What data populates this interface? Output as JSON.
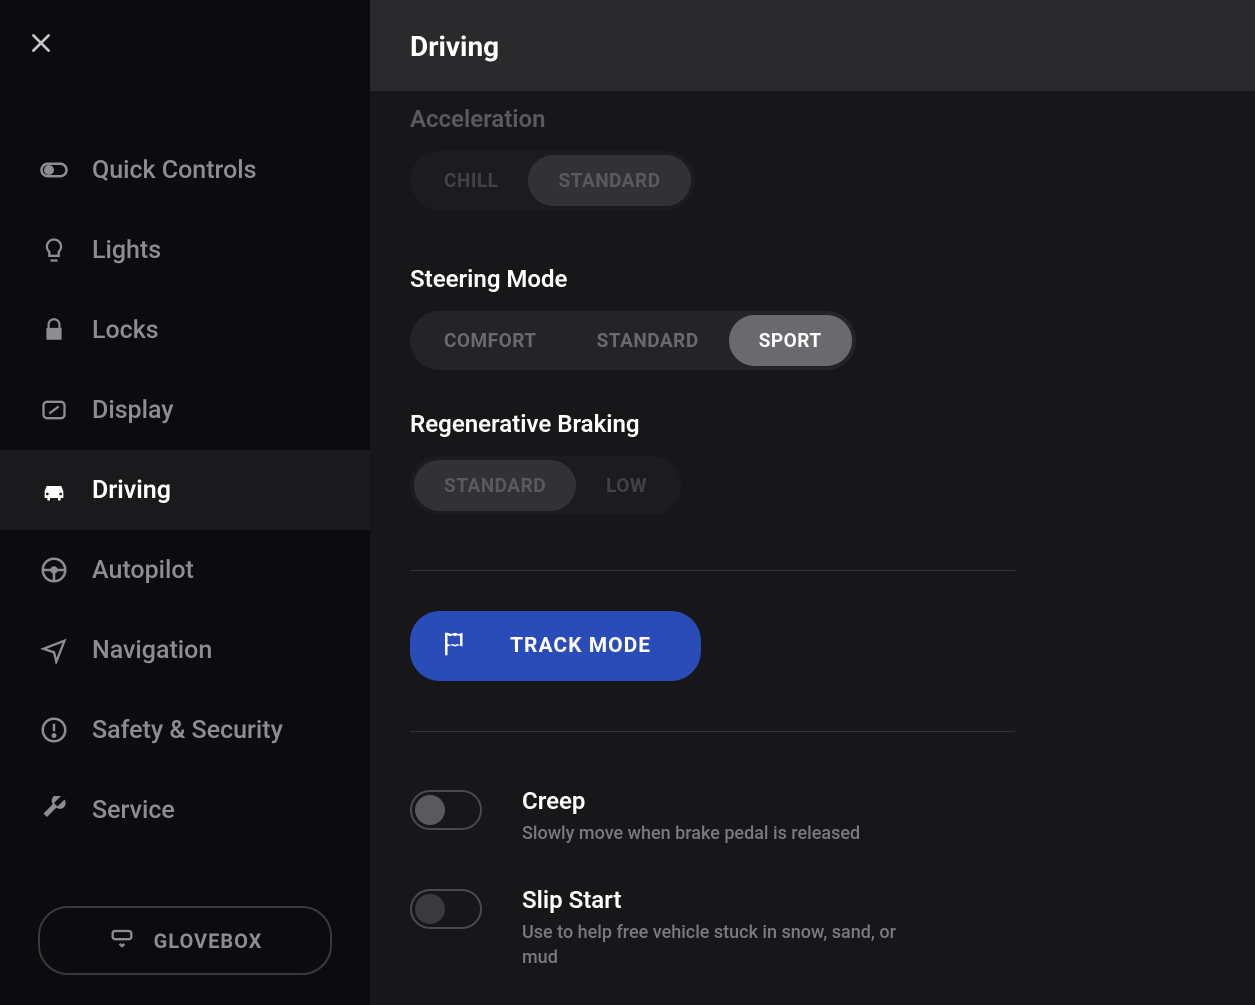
{
  "sidebar": {
    "items": [
      {
        "label": "Quick Controls"
      },
      {
        "label": "Lights"
      },
      {
        "label": "Locks"
      },
      {
        "label": "Display"
      },
      {
        "label": "Driving"
      },
      {
        "label": "Autopilot"
      },
      {
        "label": "Navigation"
      },
      {
        "label": "Safety & Security"
      },
      {
        "label": "Service"
      }
    ],
    "glovebox_label": "GLOVEBOX"
  },
  "header": {
    "title": "Driving"
  },
  "content": {
    "acceleration": {
      "title": "Acceleration",
      "options": [
        "CHILL",
        "STANDARD"
      ],
      "selected": "STANDARD"
    },
    "steering": {
      "title": "Steering Mode",
      "options": [
        "COMFORT",
        "STANDARD",
        "SPORT"
      ],
      "selected": "SPORT"
    },
    "regen": {
      "title": "Regenerative Braking",
      "options": [
        "STANDARD",
        "LOW"
      ],
      "selected": "STANDARD"
    },
    "track_mode_label": "TRACK MODE",
    "creep": {
      "title": "Creep",
      "desc": "Slowly move when brake pedal is released",
      "enabled": false
    },
    "slip_start": {
      "title": "Slip Start",
      "desc": "Use to help free vehicle stuck in snow, sand, or mud",
      "enabled": false
    }
  }
}
